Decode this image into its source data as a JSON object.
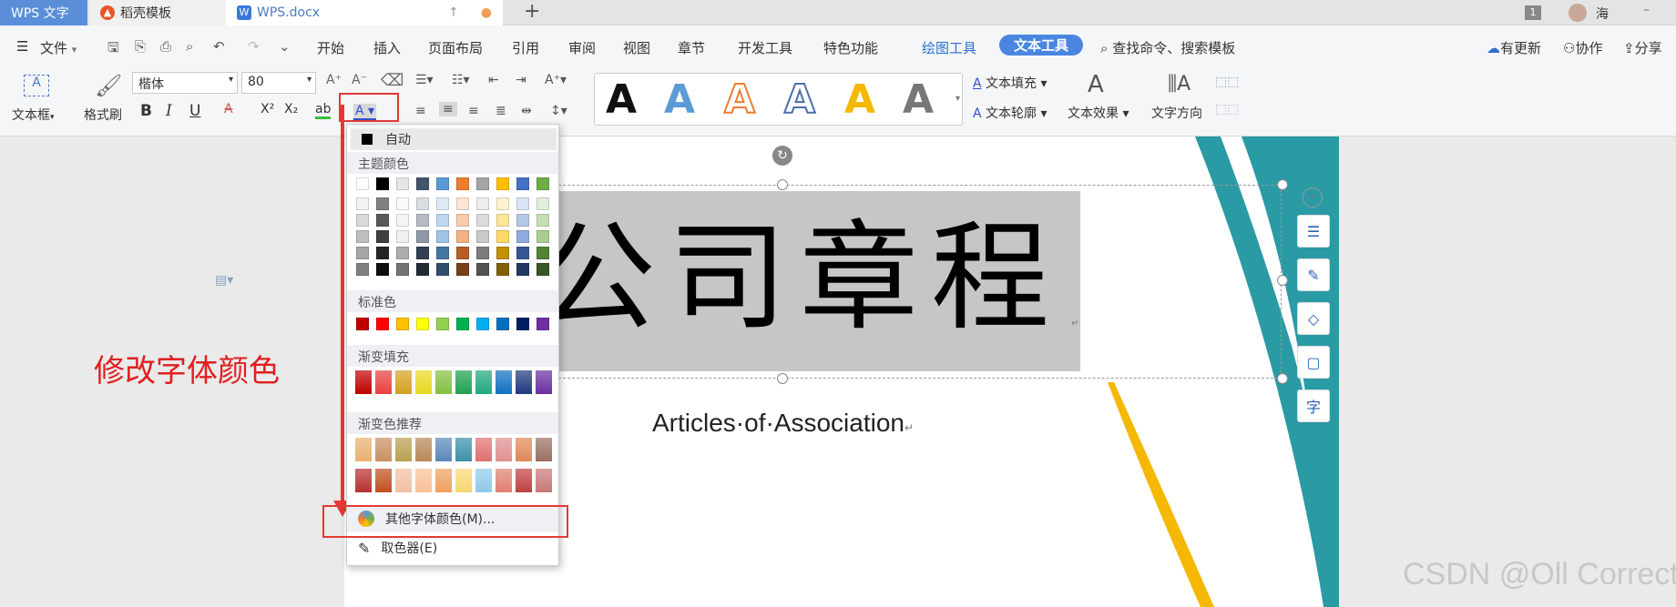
{
  "tabs": {
    "app": "WPS 文字",
    "template": "稻壳模板",
    "doc": "WPS.docx",
    "plus": "+",
    "badge": "1",
    "user": "海"
  },
  "menu": {
    "file": "文件",
    "items": [
      "开始",
      "插入",
      "页面布局",
      "引用",
      "审阅",
      "视图",
      "章节",
      "开发工具",
      "特色功能"
    ],
    "drawing_tools": "绘图工具",
    "text_tools": "文本工具",
    "search": "查找命令、搜索模板",
    "update": "有更新",
    "collab": "协作",
    "share": "分享"
  },
  "ribbon": {
    "textbox": "文本框",
    "format_painter": "格式刷",
    "font_name": "楷体",
    "font_size": "80",
    "bold": "B",
    "italic": "I",
    "underline": "U",
    "text_fill": "文本填充",
    "text_outline": "文本轮廓",
    "text_effect": "文本效果",
    "text_direction": "文字方向"
  },
  "document": {
    "title": "公司章程",
    "subtitle": "Articles·of·Association"
  },
  "color_menu": {
    "auto": "自动",
    "theme_colors": "主题颜色",
    "standard_colors": "标准色",
    "gradient_fill": "渐变填充",
    "gradient_recommend": "渐变色推荐",
    "more_colors": "其他字体颜色(M)...",
    "eyedropper": "取色器(E)",
    "theme_row": [
      "#ffffff",
      "#000000",
      "#e7e6e6",
      "#44546a",
      "#5b9bd5",
      "#ed7d31",
      "#a5a5a5",
      "#ffc000",
      "#4472c4",
      "#70ad47"
    ],
    "standard_row": [
      "#c00000",
      "#ff0000",
      "#ffc000",
      "#ffff00",
      "#92d050",
      "#00b050",
      "#00b0f0",
      "#0070c0",
      "#002060",
      "#7030a0"
    ],
    "gradient_row": [
      "#c00000",
      "#e84040",
      "#d4a020",
      "#e8d820",
      "#82c040",
      "#20a050",
      "#20a880",
      "#1070c0",
      "#203880",
      "#6a30a0"
    ],
    "recommend_row1": [
      "#e8b070",
      "#c89060",
      "#b8a050",
      "#b88858",
      "#5a88b8",
      "#3a90a8",
      "#e07070",
      "#e09090",
      "#e08858",
      "#9a7060"
    ],
    "recommend_row2": [
      "#b83030",
      "#c05020",
      "#f0c0a0",
      "#f8c098",
      "#f0a060",
      "#f8d870",
      "#90c8e8",
      "#e08070",
      "#c04040",
      "#c87878"
    ]
  },
  "annotation": "修改字体颜色",
  "watermark": "CSDN @Oll Correct"
}
